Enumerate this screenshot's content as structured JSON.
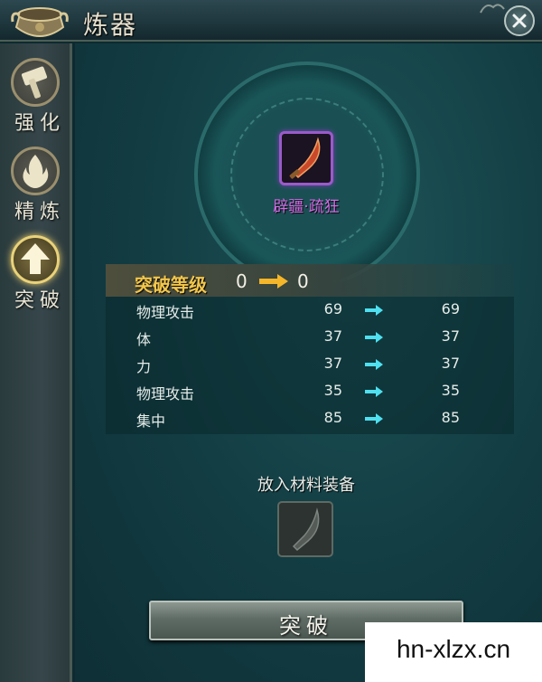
{
  "window": {
    "title": "炼器",
    "close_icon": "close-icon"
  },
  "sidebar": {
    "items": [
      {
        "label": "强化",
        "icon": "hammer-icon",
        "active": false
      },
      {
        "label": "精炼",
        "icon": "flame-icon",
        "active": false
      },
      {
        "label": "突破",
        "icon": "upgrade-arrow-icon",
        "active": true
      }
    ]
  },
  "equipment": {
    "name": "辟疆·疏狂",
    "icon": "curved-blade-icon",
    "name_color": "#d46ae6",
    "frame_color": "#9b5ac9"
  },
  "breakthrough": {
    "label": "突破等级",
    "from": "0",
    "to": "0"
  },
  "stats": [
    {
      "name": "物理攻击",
      "before": "69",
      "after": "69"
    },
    {
      "name": "体",
      "before": "37",
      "after": "37"
    },
    {
      "name": "力",
      "before": "37",
      "after": "37"
    },
    {
      "name": "物理攻击",
      "before": "35",
      "after": "35"
    },
    {
      "name": "集中",
      "before": "85",
      "after": "85"
    }
  ],
  "material": {
    "label": "放入材料装备",
    "icon": "blade-silhouette-icon"
  },
  "action": {
    "break_label": "突破"
  },
  "watermark": {
    "text": "hn-xlzx.cn"
  },
  "colors": {
    "accent_gold": "#f3c64a",
    "arrow_cyan": "#4fe0f0",
    "panel_teal": "#1d5357"
  }
}
